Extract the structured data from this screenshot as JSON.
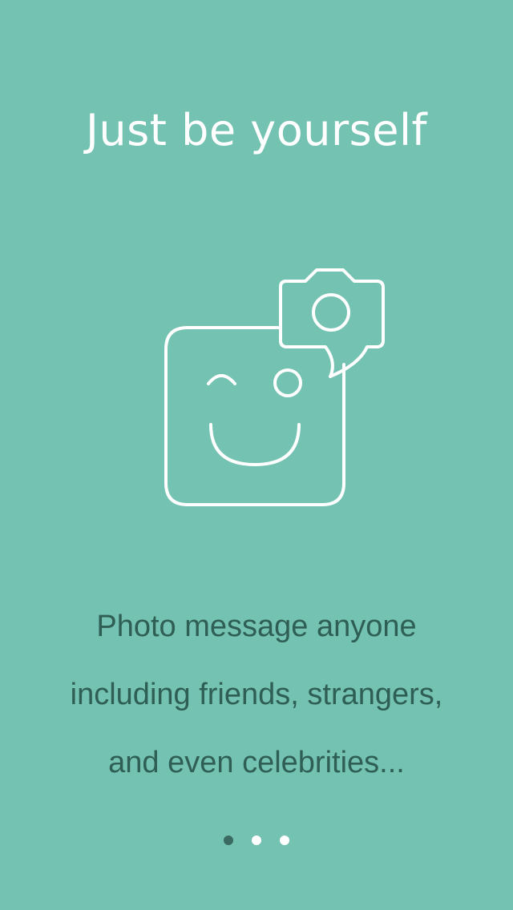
{
  "screen": {
    "title": "Just be yourself",
    "message_lines": [
      "Photo message anyone",
      "including friends, strangers,",
      "and even celebrities..."
    ]
  },
  "illustration": {
    "icons": [
      "smiley-face-icon",
      "camera-speech-bubble-icon"
    ]
  },
  "pager": {
    "total_pages": 3,
    "active_page": 1
  },
  "colors": {
    "background": "#74c2b1",
    "title_text": "#ffffff",
    "message_text": "#2f5e55",
    "dot_active": "#3a6a61",
    "dot_inactive": "#ffffff"
  }
}
